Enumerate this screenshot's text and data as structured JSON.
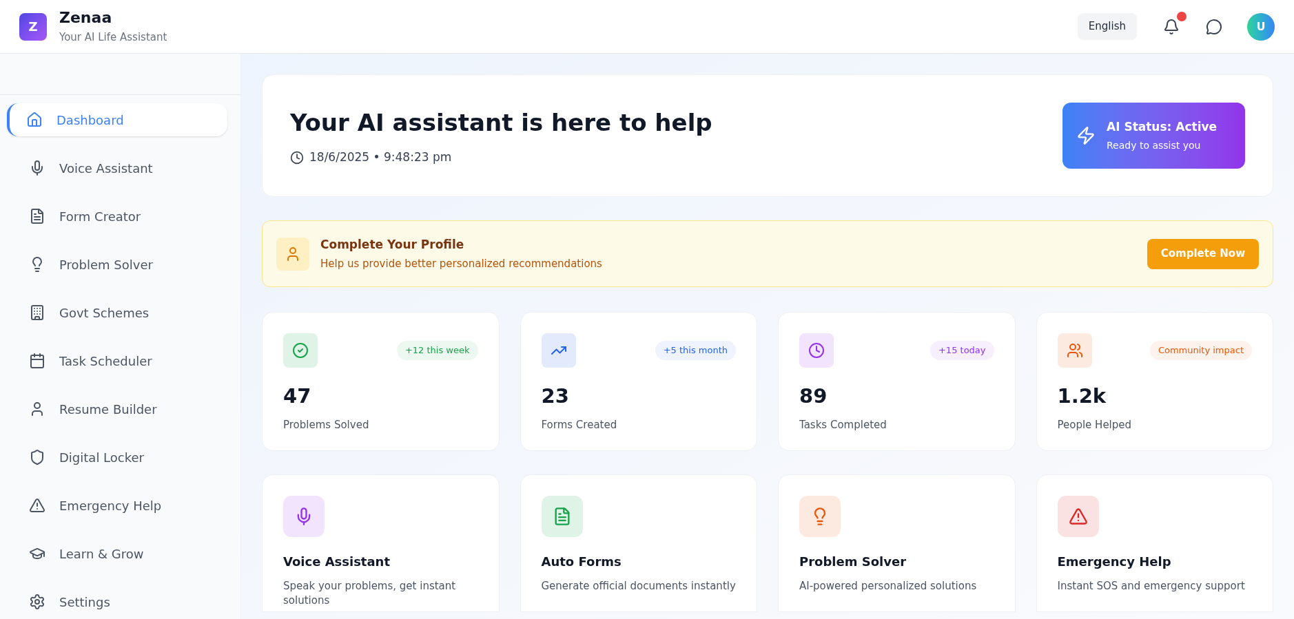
{
  "app": {
    "logo_letter": "Z",
    "name": "Zenaa",
    "tagline": "Your AI Life Assistant"
  },
  "header": {
    "language": "English",
    "notifications_unread": true,
    "avatar_letter": "U"
  },
  "sidebar": {
    "items": [
      {
        "label": "Dashboard",
        "selected": true
      },
      {
        "label": "Voice Assistant",
        "selected": false
      },
      {
        "label": "Form Creator",
        "selected": false
      },
      {
        "label": "Problem Solver",
        "selected": false
      },
      {
        "label": "Govt Schemes",
        "selected": false
      },
      {
        "label": "Task Scheduler",
        "selected": false
      },
      {
        "label": "Resume Builder",
        "selected": false
      },
      {
        "label": "Digital Locker",
        "selected": false
      },
      {
        "label": "Emergency Help",
        "selected": false
      },
      {
        "label": "Learn & Grow",
        "selected": false
      },
      {
        "label": "Settings",
        "selected": false
      }
    ]
  },
  "hero": {
    "title": "Your AI assistant is here to help",
    "datetime": "18/6/2025 • 9:48:23 pm",
    "status_title": "AI Status: Active",
    "status_subtitle": "Ready to assist you"
  },
  "profile_banner": {
    "title": "Complete Your Profile",
    "text": "Help us provide better personalized recommendations",
    "button": "Complete Now"
  },
  "stats": [
    {
      "color": "#16a34a",
      "badge": "+12 this week",
      "value": "47",
      "label": "Problems Solved"
    },
    {
      "color": "#2563eb",
      "badge": "+5 this month",
      "value": "23",
      "label": "Forms Created"
    },
    {
      "color": "#9333ea",
      "badge": "+15 today",
      "value": "89",
      "label": "Tasks Completed"
    },
    {
      "color": "#ea580c",
      "badge": "Community impact",
      "value": "1.2k",
      "label": "People Helped"
    }
  ],
  "features": [
    {
      "color": "#9333ea",
      "title": "Voice Assistant",
      "text": "Speak your problems, get instant solutions"
    },
    {
      "color": "#16a34a",
      "title": "Auto Forms",
      "text": "Generate official documents instantly"
    },
    {
      "color": "#ea580c",
      "title": "Problem Solver",
      "text": "AI-powered personalized solutions"
    },
    {
      "color": "#dc2626",
      "title": "Emergency Help",
      "text": "Instant SOS and emergency support"
    }
  ]
}
